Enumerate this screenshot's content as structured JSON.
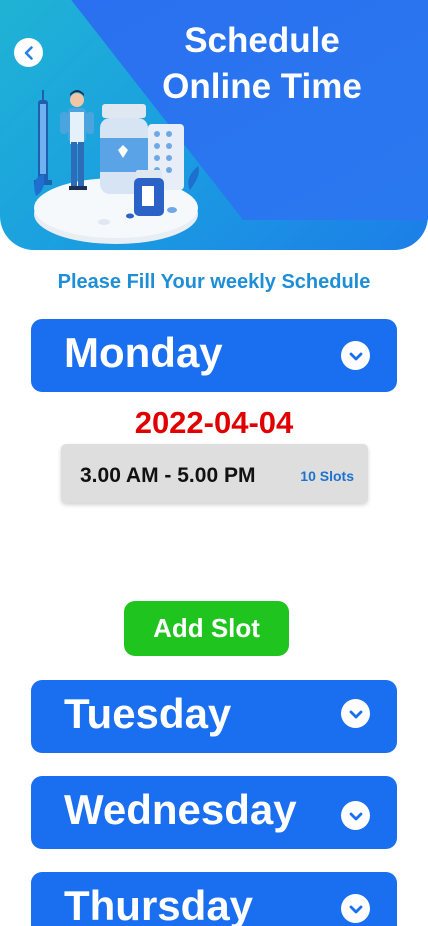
{
  "header": {
    "title_line1": "Schedule",
    "title_line2": "Online Time",
    "back_icon": "chevron-left-icon"
  },
  "subtitle": "Please Fill Your weekly Schedule",
  "days": [
    {
      "label": "Monday",
      "expanded": true
    },
    {
      "label": "Tuesday",
      "expanded": false
    },
    {
      "label": "Wednesday",
      "expanded": false
    },
    {
      "label": "Thursday",
      "expanded": false
    }
  ],
  "monday_detail": {
    "date": "2022-04-04",
    "slots": [
      {
        "time": "3.00 AM - 5.00 PM",
        "count": "10 Slots"
      }
    ]
  },
  "add_slot_label": "Add Slot",
  "colors": {
    "primary_blue": "#1a6ff0",
    "date_red": "#e00000",
    "add_green": "#1fc41f",
    "subtitle_blue": "#1e8fd6"
  }
}
